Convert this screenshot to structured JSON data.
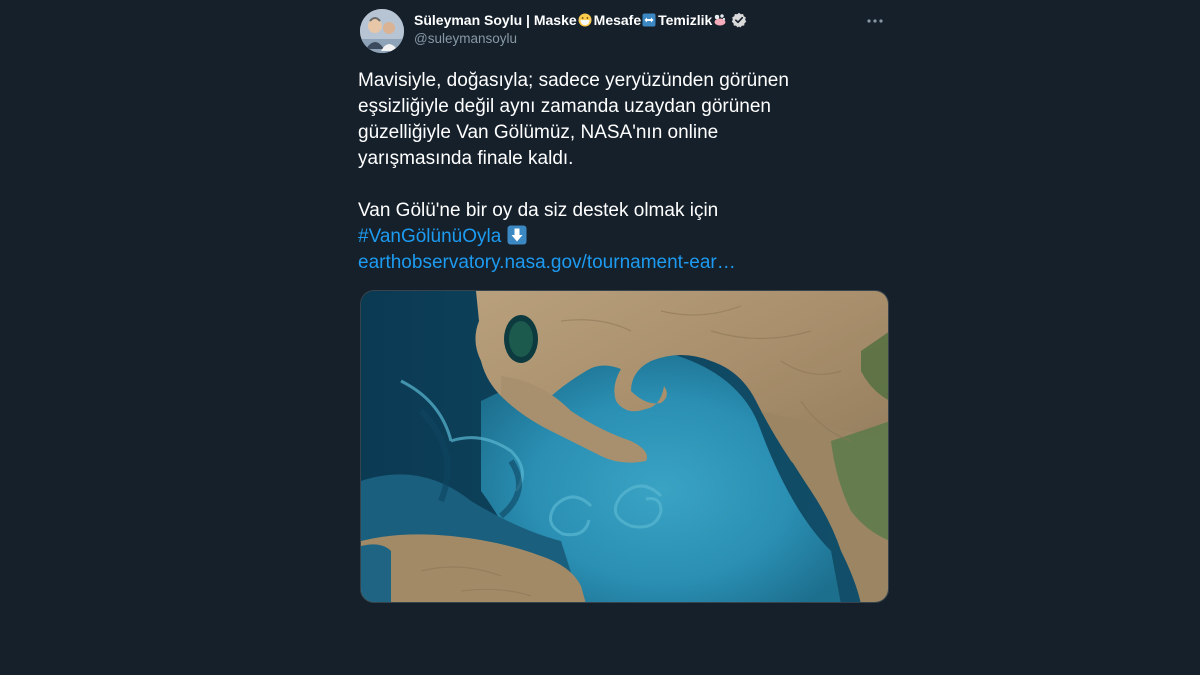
{
  "tweet": {
    "display_name": "Süleyman Soylu | Maske",
    "name_part_2": "Mesafe",
    "name_part_3": "Temizlik",
    "handle": "@suleymansoylu",
    "verified": true,
    "icons": {
      "mask": "face-with-medical-mask-emoji",
      "arrows": "left-right-arrow-emoji",
      "soap": "soap-bubbles-emoji",
      "verified": "verified-badge-icon",
      "more": "more-options-icon",
      "down_arrow": "down-arrow-emoji"
    },
    "text_lines": [
      "Mavisiyle, doğasıyla; sadece yeryüzünden görünen",
      "eşsizliğiyle değil aynı zamanda uzaydan görünen",
      "güzelliğiyle Van Gölümüz, NASA'nın online",
      "yarışmasında finale kaldı."
    ],
    "text_line_5": "Van Gölü'ne bir oy da siz destek olmak için",
    "hashtag": "#VanGölünüOyla",
    "link": "earthobservatory.nasa.gov/tournament-ear…",
    "media_alt": "Satellite image of Lake Van"
  },
  "colors": {
    "background": "#15202b",
    "text": "#ffffff",
    "secondary": "#8899a6",
    "link": "#1d9bf0",
    "verified": "#d9d9d9"
  }
}
